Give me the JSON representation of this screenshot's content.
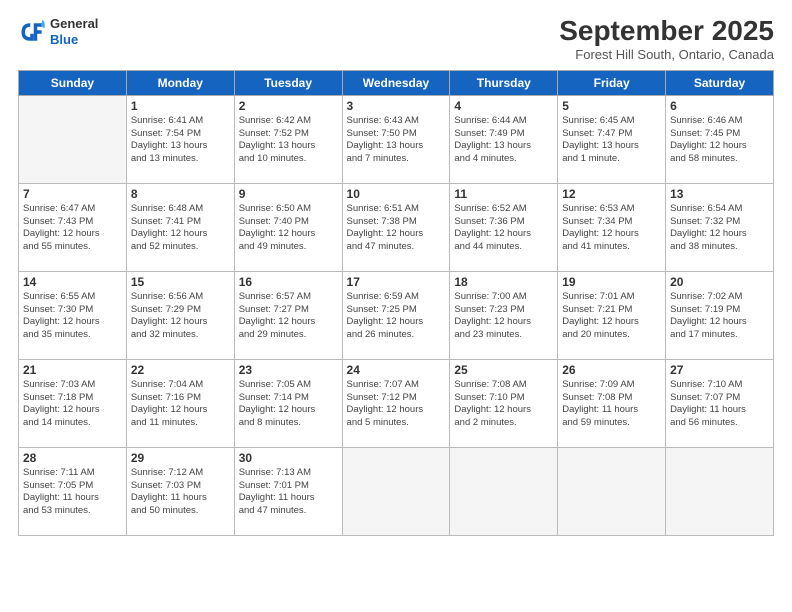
{
  "header": {
    "logo_general": "General",
    "logo_blue": "Blue",
    "month_title": "September 2025",
    "location": "Forest Hill South, Ontario, Canada"
  },
  "days_of_week": [
    "Sunday",
    "Monday",
    "Tuesday",
    "Wednesday",
    "Thursday",
    "Friday",
    "Saturday"
  ],
  "weeks": [
    [
      {
        "day": "",
        "info": ""
      },
      {
        "day": "1",
        "info": "Sunrise: 6:41 AM\nSunset: 7:54 PM\nDaylight: 13 hours\nand 13 minutes."
      },
      {
        "day": "2",
        "info": "Sunrise: 6:42 AM\nSunset: 7:52 PM\nDaylight: 13 hours\nand 10 minutes."
      },
      {
        "day": "3",
        "info": "Sunrise: 6:43 AM\nSunset: 7:50 PM\nDaylight: 13 hours\nand 7 minutes."
      },
      {
        "day": "4",
        "info": "Sunrise: 6:44 AM\nSunset: 7:49 PM\nDaylight: 13 hours\nand 4 minutes."
      },
      {
        "day": "5",
        "info": "Sunrise: 6:45 AM\nSunset: 7:47 PM\nDaylight: 13 hours\nand 1 minute."
      },
      {
        "day": "6",
        "info": "Sunrise: 6:46 AM\nSunset: 7:45 PM\nDaylight: 12 hours\nand 58 minutes."
      }
    ],
    [
      {
        "day": "7",
        "info": "Sunrise: 6:47 AM\nSunset: 7:43 PM\nDaylight: 12 hours\nand 55 minutes."
      },
      {
        "day": "8",
        "info": "Sunrise: 6:48 AM\nSunset: 7:41 PM\nDaylight: 12 hours\nand 52 minutes."
      },
      {
        "day": "9",
        "info": "Sunrise: 6:50 AM\nSunset: 7:40 PM\nDaylight: 12 hours\nand 49 minutes."
      },
      {
        "day": "10",
        "info": "Sunrise: 6:51 AM\nSunset: 7:38 PM\nDaylight: 12 hours\nand 47 minutes."
      },
      {
        "day": "11",
        "info": "Sunrise: 6:52 AM\nSunset: 7:36 PM\nDaylight: 12 hours\nand 44 minutes."
      },
      {
        "day": "12",
        "info": "Sunrise: 6:53 AM\nSunset: 7:34 PM\nDaylight: 12 hours\nand 41 minutes."
      },
      {
        "day": "13",
        "info": "Sunrise: 6:54 AM\nSunset: 7:32 PM\nDaylight: 12 hours\nand 38 minutes."
      }
    ],
    [
      {
        "day": "14",
        "info": "Sunrise: 6:55 AM\nSunset: 7:30 PM\nDaylight: 12 hours\nand 35 minutes."
      },
      {
        "day": "15",
        "info": "Sunrise: 6:56 AM\nSunset: 7:29 PM\nDaylight: 12 hours\nand 32 minutes."
      },
      {
        "day": "16",
        "info": "Sunrise: 6:57 AM\nSunset: 7:27 PM\nDaylight: 12 hours\nand 29 minutes."
      },
      {
        "day": "17",
        "info": "Sunrise: 6:59 AM\nSunset: 7:25 PM\nDaylight: 12 hours\nand 26 minutes."
      },
      {
        "day": "18",
        "info": "Sunrise: 7:00 AM\nSunset: 7:23 PM\nDaylight: 12 hours\nand 23 minutes."
      },
      {
        "day": "19",
        "info": "Sunrise: 7:01 AM\nSunset: 7:21 PM\nDaylight: 12 hours\nand 20 minutes."
      },
      {
        "day": "20",
        "info": "Sunrise: 7:02 AM\nSunset: 7:19 PM\nDaylight: 12 hours\nand 17 minutes."
      }
    ],
    [
      {
        "day": "21",
        "info": "Sunrise: 7:03 AM\nSunset: 7:18 PM\nDaylight: 12 hours\nand 14 minutes."
      },
      {
        "day": "22",
        "info": "Sunrise: 7:04 AM\nSunset: 7:16 PM\nDaylight: 12 hours\nand 11 minutes."
      },
      {
        "day": "23",
        "info": "Sunrise: 7:05 AM\nSunset: 7:14 PM\nDaylight: 12 hours\nand 8 minutes."
      },
      {
        "day": "24",
        "info": "Sunrise: 7:07 AM\nSunset: 7:12 PM\nDaylight: 12 hours\nand 5 minutes."
      },
      {
        "day": "25",
        "info": "Sunrise: 7:08 AM\nSunset: 7:10 PM\nDaylight: 12 hours\nand 2 minutes."
      },
      {
        "day": "26",
        "info": "Sunrise: 7:09 AM\nSunset: 7:08 PM\nDaylight: 11 hours\nand 59 minutes."
      },
      {
        "day": "27",
        "info": "Sunrise: 7:10 AM\nSunset: 7:07 PM\nDaylight: 11 hours\nand 56 minutes."
      }
    ],
    [
      {
        "day": "28",
        "info": "Sunrise: 7:11 AM\nSunset: 7:05 PM\nDaylight: 11 hours\nand 53 minutes."
      },
      {
        "day": "29",
        "info": "Sunrise: 7:12 AM\nSunset: 7:03 PM\nDaylight: 11 hours\nand 50 minutes."
      },
      {
        "day": "30",
        "info": "Sunrise: 7:13 AM\nSunset: 7:01 PM\nDaylight: 11 hours\nand 47 minutes."
      },
      {
        "day": "",
        "info": ""
      },
      {
        "day": "",
        "info": ""
      },
      {
        "day": "",
        "info": ""
      },
      {
        "day": "",
        "info": ""
      }
    ]
  ]
}
